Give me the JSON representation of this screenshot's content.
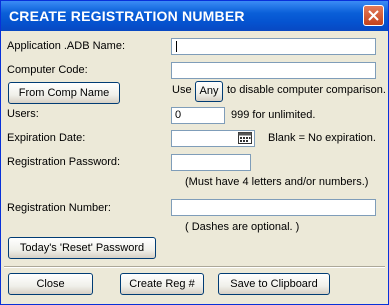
{
  "window": {
    "title": "CREATE REGISTRATION NUMBER",
    "close_icon": "close-icon"
  },
  "form": {
    "app_name_label": "Application .ADB Name:",
    "app_name_value": "",
    "computer_code_label": "Computer Code:",
    "computer_code_value": "",
    "from_comp_name_label": "From Comp Name",
    "use_label": "Use",
    "any_label": "Any",
    "disable_comparison_text": "to disable computer comparison.",
    "users_label": "Users:",
    "users_value": "0",
    "unlimited_text": "999 for unlimited.",
    "expiration_label": "Expiration Date:",
    "expiration_value": "",
    "calendar_icon": "calendar-icon",
    "blank_text": "Blank = No expiration.",
    "password_label": "Registration Password:",
    "password_value": "",
    "password_hint": "(Must have 4 letters and/or numbers.)",
    "reg_number_label": "Registration Number:",
    "reg_number_value": "",
    "dashes_hint": "( Dashes are optional. )",
    "reset_password_label": "Today's 'Reset' Password"
  },
  "footer": {
    "close_label": "Close",
    "create_label": "Create Reg #",
    "clipboard_label": "Save to Clipboard"
  },
  "colors": {
    "titlebar": "#0553d0",
    "close_button": "#c4421b",
    "dialog_bg": "#ece9d8"
  }
}
